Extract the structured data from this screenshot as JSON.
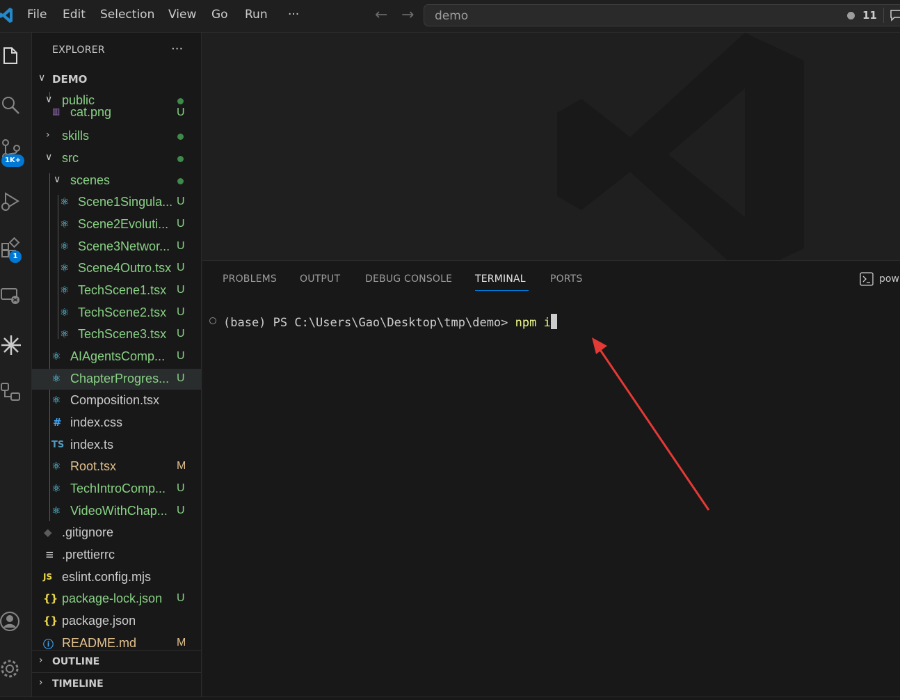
{
  "menu": [
    "File",
    "Edit",
    "Selection",
    "View",
    "Go",
    "Run",
    "···"
  ],
  "command_center": {
    "text": "demo",
    "count": "11"
  },
  "activity_bar": {
    "scm_badge": "1K+",
    "extensions_badge": "1"
  },
  "explorer": {
    "title": "EXPLORER",
    "more": "···",
    "root": "DEMO",
    "items": [
      {
        "name": "public",
        "status": "",
        "color": "#89d185"
      },
      {
        "name": "cat.png",
        "status": "U",
        "color": "#89d185"
      },
      {
        "name": "skills",
        "status": "",
        "color": "#89d185"
      },
      {
        "name": "src",
        "status": "",
        "color": "#89d185"
      },
      {
        "name": "scenes",
        "status": "",
        "color": "#89d185"
      },
      {
        "name": "Scene1Singula...",
        "status": "U",
        "color": "#89d185"
      },
      {
        "name": "Scene2Evoluti...",
        "status": "U",
        "color": "#89d185"
      },
      {
        "name": "Scene3Networ...",
        "status": "U",
        "color": "#89d185"
      },
      {
        "name": "Scene4Outro.tsx",
        "status": "U",
        "color": "#89d185"
      },
      {
        "name": "TechScene1.tsx",
        "status": "U",
        "color": "#89d185"
      },
      {
        "name": "TechScene2.tsx",
        "status": "U",
        "color": "#89d185"
      },
      {
        "name": "TechScene3.tsx",
        "status": "U",
        "color": "#89d185"
      },
      {
        "name": "AIAgentsComp...",
        "status": "U",
        "color": "#89d185"
      },
      {
        "name": "ChapterProgres...",
        "status": "U",
        "color": "#89d185"
      },
      {
        "name": "Composition.tsx",
        "status": "",
        "color": "#cccccc"
      },
      {
        "name": "index.css",
        "status": "",
        "color": "#cccccc"
      },
      {
        "name": "index.ts",
        "status": "",
        "color": "#cccccc"
      },
      {
        "name": "Root.tsx",
        "status": "M",
        "color": "#e2c08d"
      },
      {
        "name": "TechIntroComp...",
        "status": "U",
        "color": "#89d185"
      },
      {
        "name": "VideoWithChap...",
        "status": "U",
        "color": "#89d185"
      },
      {
        "name": ".gitignore",
        "status": "",
        "color": "#cccccc"
      },
      {
        "name": ".prettierrc",
        "status": "",
        "color": "#cccccc"
      },
      {
        "name": "eslint.config.mjs",
        "status": "",
        "color": "#cccccc"
      },
      {
        "name": "package-lock.json",
        "status": "U",
        "color": "#89d185"
      },
      {
        "name": "package.json",
        "status": "",
        "color": "#cccccc"
      },
      {
        "name": "README.md",
        "status": "M",
        "color": "#e2c08d"
      }
    ],
    "outline": "OUTLINE",
    "timeline": "TIMELINE"
  },
  "panel": {
    "tabs": [
      "PROBLEMS",
      "OUTPUT",
      "DEBUG CONSOLE",
      "TERMINAL",
      "PORTS"
    ],
    "active_tab": "TERMINAL",
    "terminal_label": "pow",
    "prompt": "(base) PS C:\\Users\\Gao\\Desktop\\tmp\\demo> ",
    "command": "npm i"
  },
  "colors": {
    "accent": "#0078d4",
    "untracked": "#89d185",
    "modified": "#e2c08d",
    "annotation_arrow": "#e53935",
    "command_yellow": "#f1fa8c"
  }
}
